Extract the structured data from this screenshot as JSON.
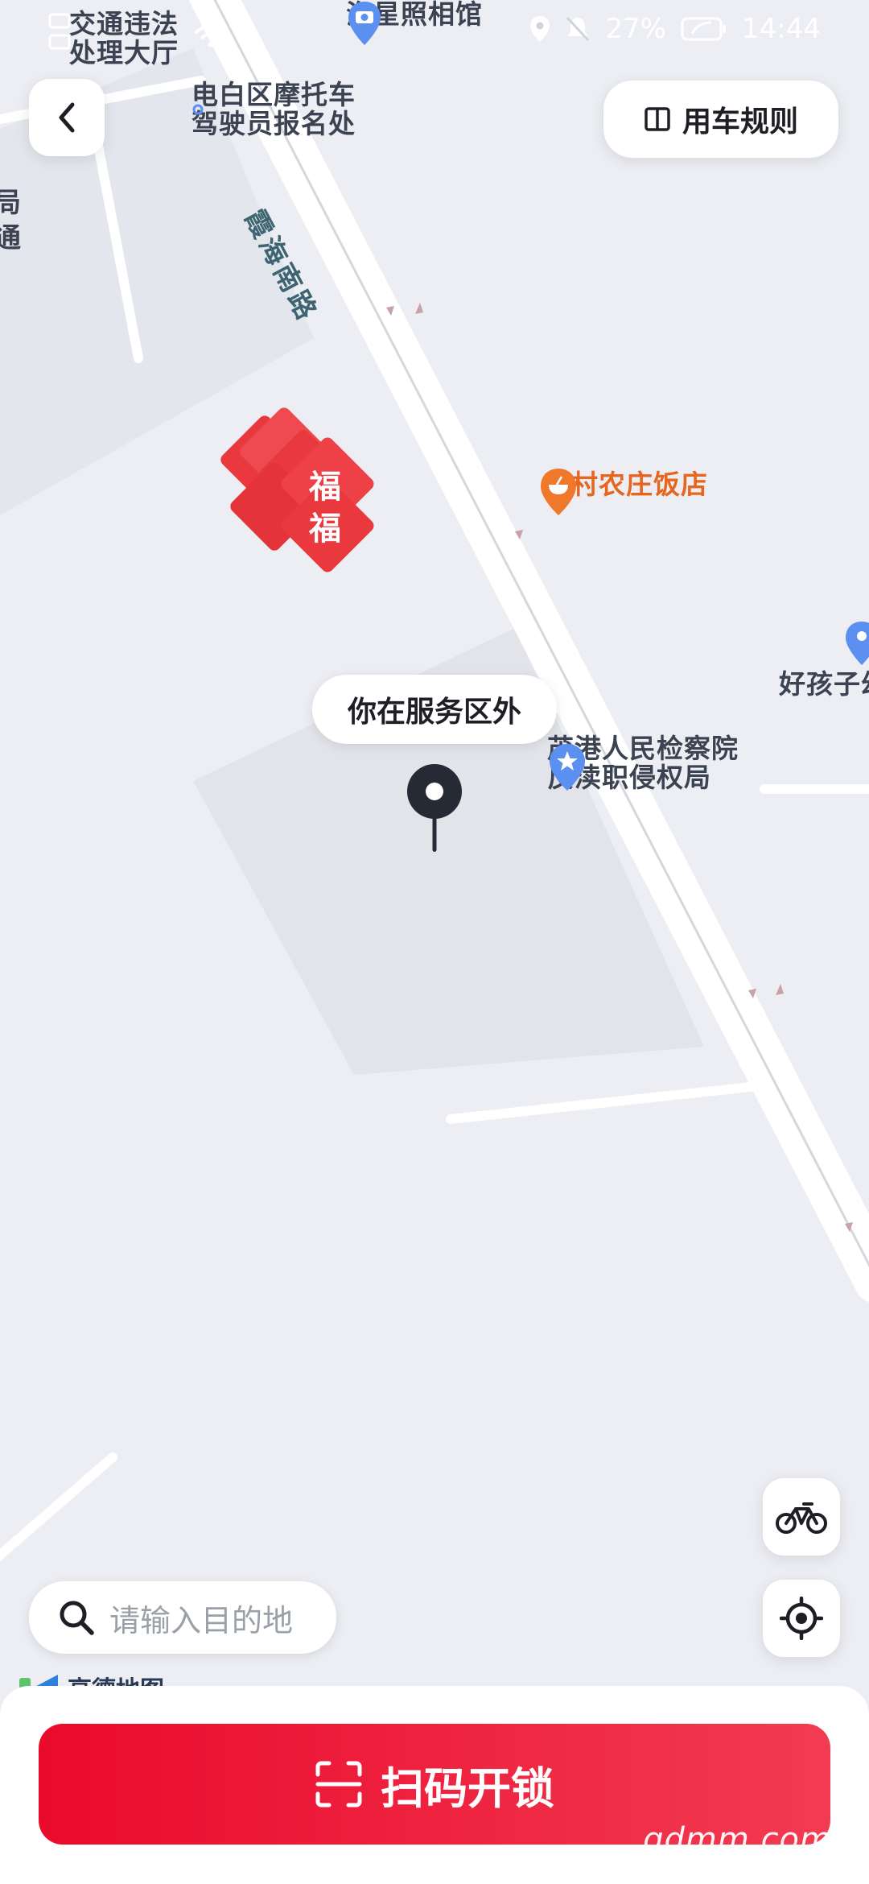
{
  "status_bar": {
    "battery": "27%",
    "time": "14:44",
    "colors": {
      "text": "#ffffff"
    }
  },
  "header": {
    "back_icon": "chevron-left-icon",
    "rules_label": "用车规则",
    "rules_icon": "book-icon"
  },
  "map": {
    "pois": [
      {
        "label_line1": "交通违法",
        "label_line2": "处理大厅"
      },
      {
        "label": "海星照相馆",
        "icon": "camera-icon"
      },
      {
        "label_line1": "电白区摩托车",
        "label_line2": "驾驶员报名处"
      },
      {
        "label": "霞海南路"
      },
      {
        "label": "新村农庄饭店",
        "icon": "restaurant-icon"
      },
      {
        "label": "好孩子幼"
      },
      {
        "label_line1": "茂港人民检察院",
        "label_line2": "反渎职侵权局",
        "icon": "government-icon"
      }
    ],
    "edge_chars": [
      "局",
      "通"
    ],
    "fu_char": "福",
    "location_bubble": "你在服务区外",
    "colors": {
      "accent_red": "#ea0a2c",
      "restaurant_orange": "#e8651d",
      "poi_blue": "#5b8ff0"
    }
  },
  "controls": {
    "bike_icon": "bicycle-icon",
    "locate_icon": "crosshair-icon"
  },
  "search": {
    "placeholder": "请输入目的地",
    "icon": "search-icon"
  },
  "map_provider": {
    "name": "高德地图"
  },
  "bottom": {
    "scan_label": "扫码开锁",
    "scan_icon": "scan-icon"
  },
  "watermark": "gdmm.com"
}
